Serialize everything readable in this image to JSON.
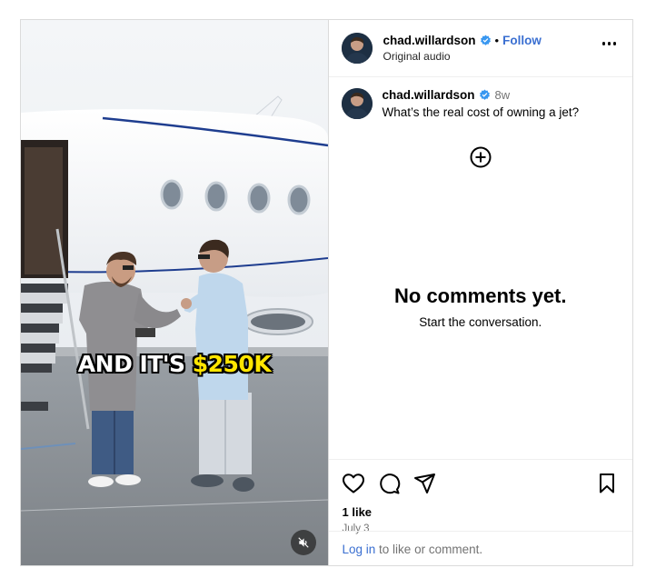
{
  "post": {
    "username": "chad.willardson",
    "verified": true,
    "separator": "•",
    "follow_label": "Follow",
    "audio_label": "Original audio",
    "caption_time": "8w",
    "caption_text": "What’s the real cost of owning a jet?",
    "likes": "1 like",
    "date": "July 3"
  },
  "media": {
    "overlay_text_white": "AND IT'S ",
    "overlay_text_yellow": "$250K"
  },
  "comments": {
    "empty_title": "No comments yet.",
    "empty_subtitle": "Start the conversation."
  },
  "footer": {
    "login_link": "Log in",
    "login_suffix": " to like or comment."
  },
  "colors": {
    "link_blue": "#3a6fd1",
    "verified_blue": "#3897f0",
    "overlay_yellow": "#ffe600",
    "muted_text": "#737373"
  },
  "icons": {
    "more": "more-horizontal-icon",
    "add_comment": "plus-circle-icon",
    "like": "heart-icon",
    "comment": "comment-icon",
    "share": "send-icon",
    "save": "bookmark-icon",
    "mute": "speaker-muted-icon"
  }
}
